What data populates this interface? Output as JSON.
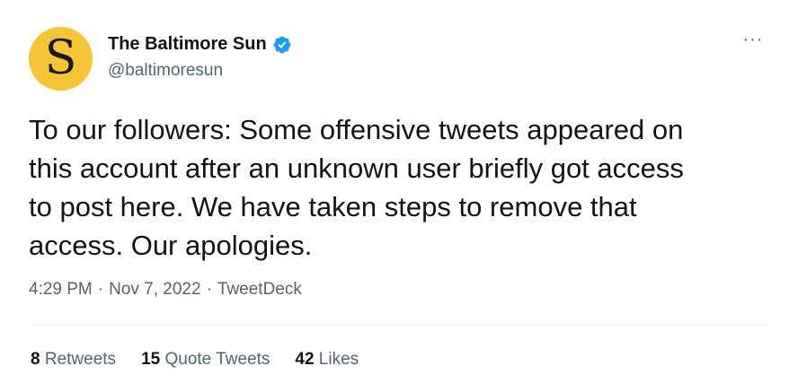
{
  "account": {
    "display_name": "The Baltimore Sun",
    "handle": "@baltimoresun",
    "avatar_letter": "S",
    "avatar_color": "#f5c537",
    "verified_icon": "verified-badge-icon"
  },
  "menu": {
    "more_label": "···"
  },
  "tweet": {
    "text": "To our followers: Some offensive tweets appeared on\nthis account after an unknown user briefly got access\nto post here. We have taken steps to remove that\naccess. Our apologies."
  },
  "meta": {
    "time": "4:29 PM",
    "separator": "·",
    "date": "Nov 7, 2022",
    "source": "TweetDeck"
  },
  "stats": {
    "retweets_count": "8",
    "retweets_label": "Retweets",
    "quote_count": "15",
    "quote_label": "Quote Tweets",
    "likes_count": "42",
    "likes_label": "Likes"
  },
  "colors": {
    "verified": "#1d9bf0",
    "secondary_text": "#536471",
    "primary_text": "#0f1419"
  }
}
